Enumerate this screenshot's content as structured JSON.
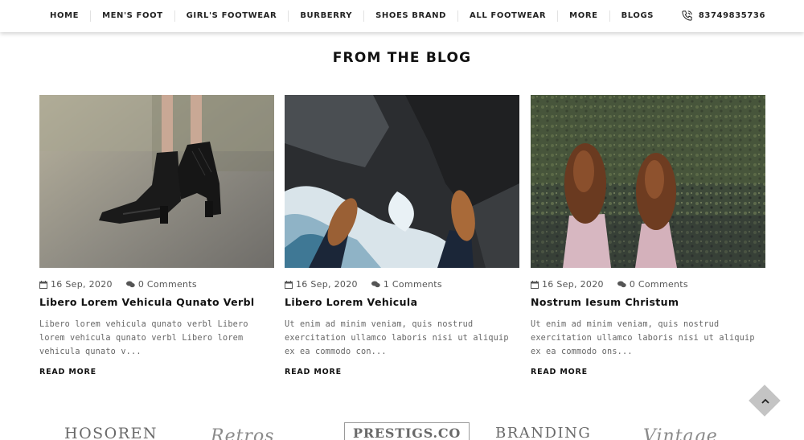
{
  "nav": {
    "items": [
      "HOME",
      "MEN'S FOOT",
      "GIRL'S FOOTWEAR",
      "BURBERRY",
      "SHOES BRAND",
      "ALL FOOTWEAR",
      "MORE",
      "BLOGS"
    ],
    "phone": "83749835736",
    "phone_icon": "phone-icon"
  },
  "section": {
    "title": "FROM THE BLOG"
  },
  "posts": [
    {
      "date": "16 Sep, 2020",
      "comments": "0 Comments",
      "title": "Libero Lorem Vehicula Qunato Verbl",
      "excerpt": "Libero lorem vehicula qunato verbl Libero lorem vehicula qunato verbl Libero lorem vehicula qunato v...",
      "read_more": "READ MORE"
    },
    {
      "date": "16 Sep, 2020",
      "comments": "1 Comments",
      "title": "Libero Lorem Vehicula",
      "excerpt": "Ut enim ad minim veniam, quis nostrud exercitation ullamco laboris nisi ut aliquip ex ea commodo con...",
      "read_more": "READ MORE"
    },
    {
      "date": "16 Sep, 2020",
      "comments": "0 Comments",
      "title": "Nostrum Iesum Christum",
      "excerpt": "Ut enim ad minim veniam, quis nostrud exercitation ullamco laboris nisi ut aliquip ex ea commodo ons...",
      "read_more": "READ MORE"
    }
  ],
  "icons": {
    "date": "calendar-icon",
    "comments": "comments-icon",
    "back_to_top": "chevron-up-icon"
  },
  "brands": [
    "HOSOREN",
    "Retros",
    "PRESTIGS.CO",
    "BRANDING",
    "Vintage"
  ],
  "colors": {
    "text": "#222222",
    "muted": "#666666",
    "back_to_top_bg": "#c4c4c4"
  }
}
